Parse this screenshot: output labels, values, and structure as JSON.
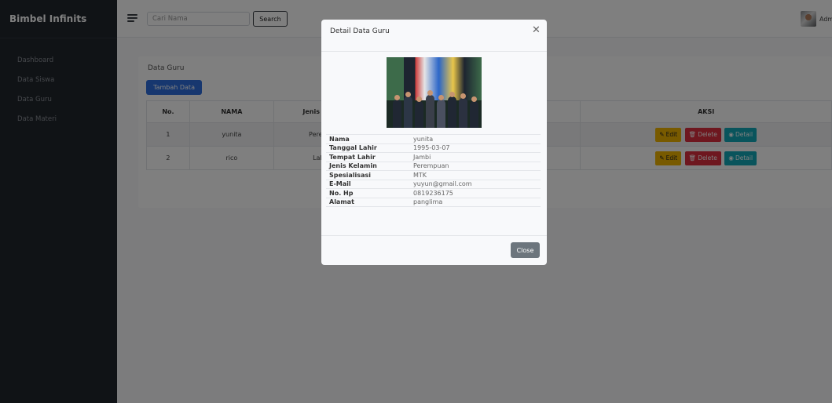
{
  "app": {
    "brand": "Bimbel Infinits"
  },
  "sidebar": {
    "items": [
      {
        "label": "Dashboard"
      },
      {
        "label": "Data Siswa"
      },
      {
        "label": "Data Guru"
      },
      {
        "label": "Data Materi"
      }
    ]
  },
  "topbar": {
    "search_placeholder": "Cari Nama",
    "search_value": "",
    "search_button": "Search",
    "user_label": "Admin"
  },
  "content": {
    "card_title": "Data Guru",
    "add_button": "Tambah Data",
    "columns": {
      "no": "No.",
      "nama": "NAMA",
      "jk": "Jenis Kelamin",
      "aksi": "AKSI"
    },
    "rows": [
      {
        "no": "1",
        "nama": "yunita",
        "jk": "Perempuan"
      },
      {
        "no": "2",
        "nama": "rico",
        "jk": "Laki-Laki"
      }
    ],
    "actions": {
      "edit": "Edit",
      "delete": "Delete",
      "detail": "Detail"
    }
  },
  "modal": {
    "title": "Detail Data Guru",
    "close_button": "Close",
    "fields": [
      {
        "label": "Nama",
        "value": "yunita"
      },
      {
        "label": "Tanggal Lahir",
        "value": "1995-03-07"
      },
      {
        "label": "Tempat Lahir",
        "value": "Jambi"
      },
      {
        "label": "Jenis Kelamin",
        "value": "Perempuan"
      },
      {
        "label": "Spesialisasi",
        "value": "MTK"
      },
      {
        "label": "E-Mail",
        "value": "yuyun@gmail.com"
      },
      {
        "label": "No. Hp",
        "value": "0819236175"
      },
      {
        "label": "Alamat",
        "value": "panglima"
      }
    ]
  },
  "colors": {
    "sidebar_bg": "#21262d",
    "primary": "#2f6fde",
    "edit": "#f0b400",
    "delete": "#dc2f3f",
    "detail": "#12a9b8",
    "secondary": "#6c757d"
  },
  "icons": {
    "menu": "hamburger-icon",
    "close": "close-x-icon",
    "edit": "pencil-square-icon",
    "delete": "trash-icon",
    "detail": "eye-icon"
  }
}
